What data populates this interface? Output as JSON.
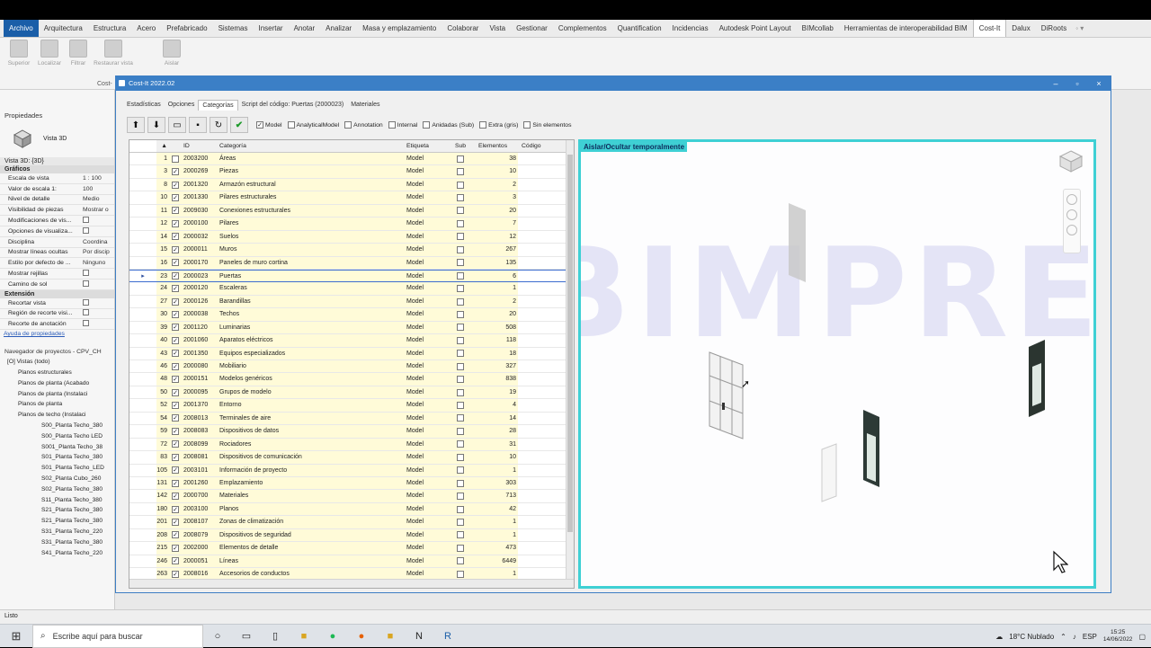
{
  "ribbon": {
    "tabs": [
      "Archivo",
      "Arquitectura",
      "Estructura",
      "Acero",
      "Prefabricado",
      "Sistemas",
      "Insertar",
      "Anotar",
      "Analizar",
      "Masa y emplazamiento",
      "Colaborar",
      "Vista",
      "Gestionar",
      "Complementos",
      "Quantification",
      "Incidencias",
      "Autodesk Point Layout",
      "BIMcollab",
      "Herramientas de interoperabilidad BIM",
      "Cost-It",
      "Dalux",
      "DiRoots"
    ],
    "active_tab": "Cost-It",
    "buttons": [
      "Superior",
      "Localizar",
      "Filtrar",
      "Restaurar vista",
      "Aislar"
    ],
    "panel_label": "Cost-"
  },
  "properties": {
    "title": "Propiedades",
    "type_name": "Vista 3D",
    "instance": "Vista 3D: {3D}",
    "group": "Gráficos",
    "rows": [
      {
        "k": "Escala de vista",
        "v": "1 : 100"
      },
      {
        "k": "Valor de escala  1:",
        "v": "100"
      },
      {
        "k": "Nivel de detalle",
        "v": "Medio"
      },
      {
        "k": "Visibilidad de piezas",
        "v": "Mostrar o"
      },
      {
        "k": "Modificaciones de vis...",
        "v": ""
      },
      {
        "k": "Opciones de visualiza...",
        "v": ""
      },
      {
        "k": "Disciplina",
        "v": "Coordina"
      },
      {
        "k": "Mostrar líneas ocultas",
        "v": "Por discip"
      },
      {
        "k": "Estilo por defecto de ...",
        "v": "Ninguno"
      },
      {
        "k": "Mostrar rejillas",
        "v": ""
      },
      {
        "k": "Camino de sol",
        "v": ""
      }
    ],
    "group2": "Extensión",
    "rows2": [
      {
        "k": "Recortar vista",
        "v": ""
      },
      {
        "k": "Región de recorte visi...",
        "v": ""
      },
      {
        "k": "Recorte de anotación",
        "v": ""
      }
    ],
    "help": "Ayuda de propiedades"
  },
  "project_browser": {
    "title": "Navegador de proyectos - CPV_CH",
    "items": [
      "[O] Vistas (todo)",
      "Planos estructurales",
      "Planos de planta (Acabado",
      "Planos de planta (Instalaci",
      "Planos de planta",
      "Planos de techo (Instalaci",
      "S00_Planta Techo_380",
      "S00_Planta Techo LED",
      "S001_Planta Techo_38",
      "S01_Planta Techo_380",
      "S01_Planta Techo_LED",
      "S02_Planta Cubo_260",
      "S02_Planta Techo_380",
      "S11_Planta Techo_380",
      "S21_Planta Techo_380",
      "S21_Planta Techo_380",
      "S31_Planta Techo_220",
      "S31_Planta Techo_380",
      "S41_Planta Techo_220"
    ]
  },
  "status_bar": "Listo",
  "dialog": {
    "title": "Cost-It 2022.02",
    "tabs": [
      "Estadísticas",
      "Opciones",
      "Categorías",
      "Script del código: Puertas (2000023)",
      "Materiales"
    ],
    "active_tab": "Categorías",
    "filters": [
      {
        "label": "Model",
        "checked": true
      },
      {
        "label": "AnalyticalModel",
        "checked": false
      },
      {
        "label": "Annotation",
        "checked": false
      },
      {
        "label": "Internal",
        "checked": false
      },
      {
        "label": "Anidadas (Sub)",
        "checked": false
      },
      {
        "label": "Extra (gris)",
        "checked": false
      },
      {
        "label": "Sin elementos",
        "checked": false
      }
    ],
    "columns": {
      "id": "ID",
      "cat": "Categoría",
      "eti": "Etiqueta",
      "sub": "Sub",
      "ele": "Elementos",
      "cod": "Código"
    },
    "rows": [
      {
        "n": "1",
        "chk": false,
        "id": "2003200",
        "cat": "Áreas",
        "eti": "Model",
        "ele": "38"
      },
      {
        "n": "3",
        "chk": true,
        "id": "2000269",
        "cat": "Piezas",
        "eti": "Model",
        "ele": "10"
      },
      {
        "n": "8",
        "chk": true,
        "id": "2001320",
        "cat": "Armazón estructural",
        "eti": "Model",
        "ele": "2"
      },
      {
        "n": "10",
        "chk": true,
        "id": "2001330",
        "cat": "Pilares estructurales",
        "eti": "Model",
        "ele": "3"
      },
      {
        "n": "11",
        "chk": true,
        "id": "2009030",
        "cat": "Conexiones estructurales",
        "eti": "Model",
        "ele": "20"
      },
      {
        "n": "12",
        "chk": true,
        "id": "2000100",
        "cat": "Pilares",
        "eti": "Model",
        "ele": "7"
      },
      {
        "n": "14",
        "chk": true,
        "id": "2000032",
        "cat": "Suelos",
        "eti": "Model",
        "ele": "12"
      },
      {
        "n": "15",
        "chk": true,
        "id": "2000011",
        "cat": "Muros",
        "eti": "Model",
        "ele": "267"
      },
      {
        "n": "16",
        "chk": true,
        "id": "2000170",
        "cat": "Paneles de muro cortina",
        "eti": "Model",
        "ele": "135"
      },
      {
        "n": "23",
        "chk": true,
        "id": "2000023",
        "cat": "Puertas",
        "eti": "Model",
        "ele": "6",
        "sel": true
      },
      {
        "n": "24",
        "chk": true,
        "id": "2000120",
        "cat": "Escaleras",
        "eti": "Model",
        "ele": "1"
      },
      {
        "n": "27",
        "chk": true,
        "id": "2000126",
        "cat": "Barandillas",
        "eti": "Model",
        "ele": "2"
      },
      {
        "n": "30",
        "chk": true,
        "id": "2000038",
        "cat": "Techos",
        "eti": "Model",
        "ele": "20"
      },
      {
        "n": "39",
        "chk": true,
        "id": "2001120",
        "cat": "Luminarias",
        "eti": "Model",
        "ele": "508"
      },
      {
        "n": "40",
        "chk": true,
        "id": "2001060",
        "cat": "Aparatos eléctricos",
        "eti": "Model",
        "ele": "118"
      },
      {
        "n": "43",
        "chk": true,
        "id": "2001350",
        "cat": "Equipos especializados",
        "eti": "Model",
        "ele": "18"
      },
      {
        "n": "46",
        "chk": true,
        "id": "2000080",
        "cat": "Mobiliario",
        "eti": "Model",
        "ele": "327"
      },
      {
        "n": "48",
        "chk": true,
        "id": "2000151",
        "cat": "Modelos genéricos",
        "eti": "Model",
        "ele": "838"
      },
      {
        "n": "50",
        "chk": true,
        "id": "2000095",
        "cat": "Grupos de modelo",
        "eti": "Model",
        "ele": "19"
      },
      {
        "n": "52",
        "chk": true,
        "id": "2001370",
        "cat": "Entorno",
        "eti": "Model",
        "ele": "4"
      },
      {
        "n": "54",
        "chk": true,
        "id": "2008013",
        "cat": "Terminales de aire",
        "eti": "Model",
        "ele": "14"
      },
      {
        "n": "59",
        "chk": true,
        "id": "2008083",
        "cat": "Dispositivos de datos",
        "eti": "Model",
        "ele": "28"
      },
      {
        "n": "72",
        "chk": true,
        "id": "2008099",
        "cat": "Rociadores",
        "eti": "Model",
        "ele": "31"
      },
      {
        "n": "83",
        "chk": true,
        "id": "2008081",
        "cat": "Dispositivos de comunicación",
        "eti": "Model",
        "ele": "10"
      },
      {
        "n": "105",
        "chk": true,
        "id": "2003101",
        "cat": "Información de proyecto",
        "eti": "Model",
        "ele": "1"
      },
      {
        "n": "131",
        "chk": true,
        "id": "2001260",
        "cat": "Emplazamiento",
        "eti": "Model",
        "ele": "303"
      },
      {
        "n": "142",
        "chk": true,
        "id": "2000700",
        "cat": "Materiales",
        "eti": "Model",
        "ele": "713"
      },
      {
        "n": "180",
        "chk": true,
        "id": "2003100",
        "cat": "Planos",
        "eti": "Model",
        "ele": "42"
      },
      {
        "n": "201",
        "chk": true,
        "id": "2008107",
        "cat": "Zonas de climatización",
        "eti": "Model",
        "ele": "1"
      },
      {
        "n": "208",
        "chk": true,
        "id": "2008079",
        "cat": "Dispositivos de seguridad",
        "eti": "Model",
        "ele": "1"
      },
      {
        "n": "215",
        "chk": true,
        "id": "2002000",
        "cat": "Elementos de detalle",
        "eti": "Model",
        "ele": "473"
      },
      {
        "n": "246",
        "chk": true,
        "id": "2000051",
        "cat": "Líneas",
        "eti": "Model",
        "ele": "6449"
      },
      {
        "n": "263",
        "chk": true,
        "id": "2008016",
        "cat": "Accesorios de conductos",
        "eti": "Model",
        "ele": "1"
      }
    ],
    "viewer_label": "Aislar/Ocultar temporalmente",
    "watermark": "BIMPRES"
  },
  "taskbar": {
    "search_placeholder": "Escribe aquí para buscar",
    "weather": "18°C  Nublado",
    "lang": "ESP",
    "time": "15:25",
    "date": "14/06/2022"
  },
  "colors": {
    "accent": "#3b7fc6",
    "viewer_border": "#3fd0d4",
    "row_yellow": "#fffbd8"
  }
}
